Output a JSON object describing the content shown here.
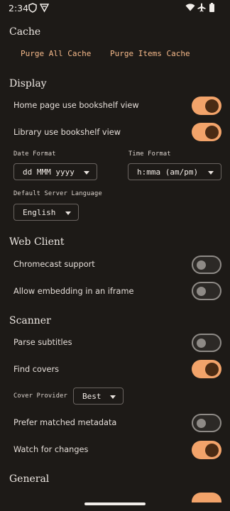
{
  "status_bar": {
    "time": "2:34",
    "left_icons": [
      "shield-icon",
      "vpn-key-icon"
    ],
    "right_icons": [
      "wifi-icon",
      "airplane-icon",
      "battery-icon"
    ]
  },
  "sections": {
    "cache": {
      "title": "Cache",
      "purge_all_label": "Purge All Cache",
      "purge_items_label": "Purge Items Cache"
    },
    "display": {
      "title": "Display",
      "home_bookshelf_label": "Home page use bookshelf view",
      "home_bookshelf_on": true,
      "library_bookshelf_label": "Library use bookshelf view",
      "library_bookshelf_on": true,
      "date_format_label": "Date Format",
      "date_format_value": "dd MMM yyyy",
      "time_format_label": "Time Format",
      "time_format_value": "h:mma (am/pm)",
      "server_language_label": "Default Server Language",
      "server_language_value": "English"
    },
    "web_client": {
      "title": "Web Client",
      "chromecast_label": "Chromecast support",
      "chromecast_on": false,
      "iframe_label": "Allow embedding in an iframe",
      "iframe_on": false
    },
    "scanner": {
      "title": "Scanner",
      "parse_subtitles_label": "Parse subtitles",
      "parse_subtitles_on": false,
      "find_covers_label": "Find covers",
      "find_covers_on": true,
      "cover_provider_label": "Cover Provider",
      "cover_provider_value": "Best",
      "prefer_matched_label": "Prefer matched metadata",
      "prefer_matched_on": false,
      "watch_changes_label": "Watch for changes",
      "watch_changes_on": true
    },
    "general": {
      "title": "General"
    }
  },
  "colors": {
    "background": "#1d1a17",
    "accent": "#f2a36a",
    "accent_text": "#f5b98a",
    "toggle_knob_on": "#4a2b14",
    "toggle_off_border": "#8e8a86"
  }
}
